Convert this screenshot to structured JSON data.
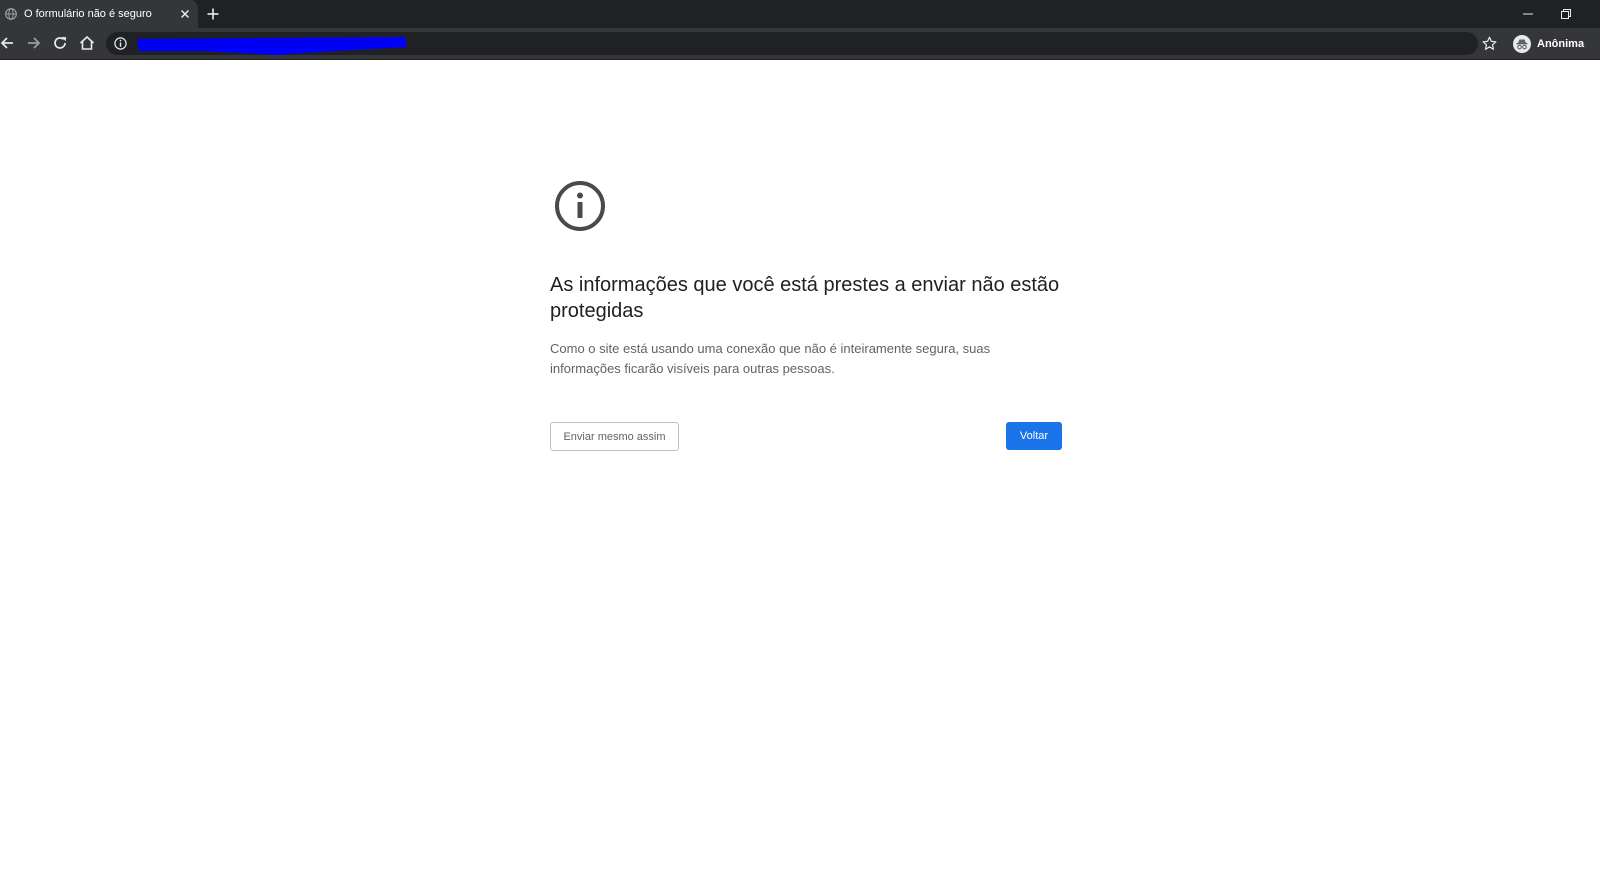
{
  "browser": {
    "tab": {
      "title": "O formulário não é seguro",
      "favicon": "globe-icon"
    },
    "toolbar": {
      "url": "",
      "profile_label": "Anônima",
      "redaction_color": "#0000ff"
    },
    "window_controls": [
      "minimize-icon",
      "restore-icon"
    ]
  },
  "page": {
    "icon": "info-icon",
    "heading": "As informações que você está prestes a enviar não estão protegidas",
    "body": "Como o site está usando uma conexão que não é inteiramente segura, suas informações ficarão visíveis para outras pessoas.",
    "secondary_button": "Enviar mesmo assim",
    "primary_button": "Voltar",
    "accent_color": "#1a73e8"
  }
}
